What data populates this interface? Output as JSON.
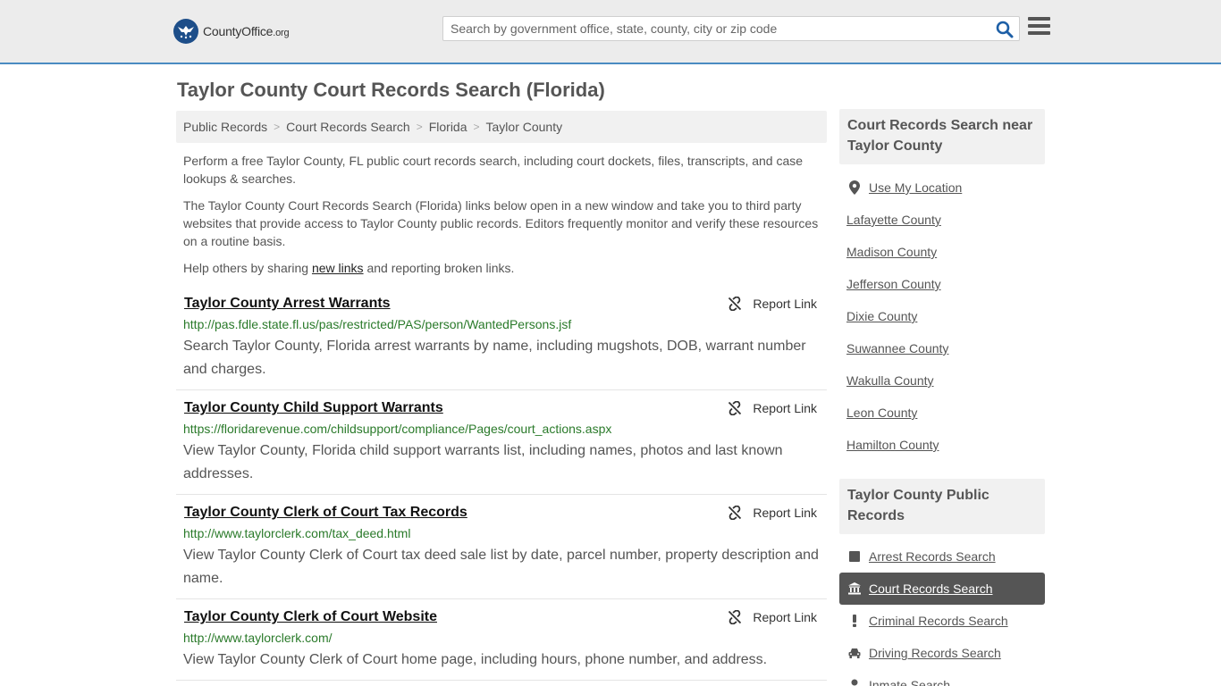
{
  "header": {
    "logo_name": "CountyOffice",
    "logo_tld": ".org",
    "search_placeholder": "Search by government office, state, county, city or zip code"
  },
  "page_title": "Taylor County Court Records Search (Florida)",
  "breadcrumb": [
    "Public Records",
    "Court Records Search",
    "Florida",
    "Taylor County"
  ],
  "intro": {
    "p1": "Perform a free Taylor County, FL public court records search, including court dockets, files, transcripts, and case lookups & searches.",
    "p2": "The Taylor County Court Records Search (Florida) links below open in a new window and take you to third party websites that provide access to Taylor County public records. Editors frequently monitor and verify these resources on a routine basis.",
    "p3_before": "Help others by sharing ",
    "p3_link": "new links",
    "p3_after": " and reporting broken links."
  },
  "report_label": "Report Link",
  "listings": [
    {
      "title": "Taylor County Arrest Warrants",
      "url": "http://pas.fdle.state.fl.us/pas/restricted/PAS/person/WantedPersons.jsf",
      "desc": "Search Taylor County, Florida arrest warrants by name, including mugshots, DOB, warrant number and charges."
    },
    {
      "title": "Taylor County Child Support Warrants",
      "url": "https://floridarevenue.com/childsupport/compliance/Pages/court_actions.aspx",
      "desc": "View Taylor County, Florida child support warrants list, including names, photos and last known addresses."
    },
    {
      "title": "Taylor County Clerk of Court Tax Records",
      "url": "http://www.taylorclerk.com/tax_deed.html",
      "desc": "View Taylor County Clerk of Court tax deed sale list by date, parcel number, property description and name."
    },
    {
      "title": "Taylor County Clerk of Court Website",
      "url": "http://www.taylorclerk.com/",
      "desc": "View Taylor County Clerk of Court home page, including hours, phone number, and address."
    }
  ],
  "sidebar": {
    "near_heading": "Court Records Search near Taylor County",
    "use_location": "Use My Location",
    "nearby": [
      "Lafayette County",
      "Madison County",
      "Jefferson County",
      "Dixie County",
      "Suwannee County",
      "Wakulla County",
      "Leon County",
      "Hamilton County"
    ],
    "public_heading": "Taylor County Public Records",
    "public_items": [
      {
        "label": "Arrest Records Search",
        "icon": "square-icon",
        "active": false
      },
      {
        "label": "Court Records Search",
        "icon": "courthouse-icon",
        "active": true
      },
      {
        "label": "Criminal Records Search",
        "icon": "exclamation-icon",
        "active": false
      },
      {
        "label": "Driving Records Search",
        "icon": "car-icon",
        "active": false
      },
      {
        "label": "Inmate Search",
        "icon": "person-icon",
        "active": false
      }
    ]
  }
}
